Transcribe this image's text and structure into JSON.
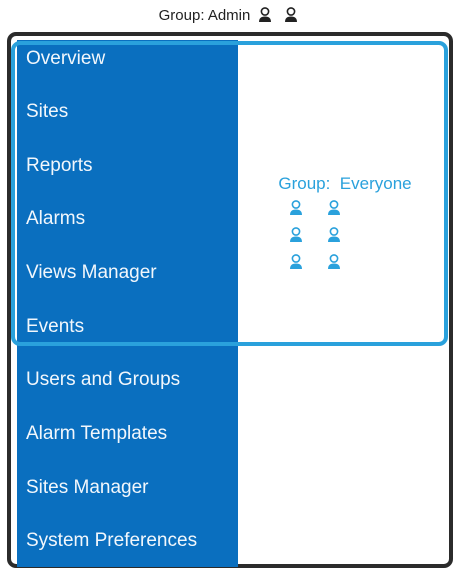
{
  "admin_group": {
    "title": "Group: Admin",
    "icons": [
      "person-icon",
      "person-icon"
    ]
  },
  "menu": {
    "items": [
      {
        "label": "Overview"
      },
      {
        "label": "Sites"
      },
      {
        "label": "Reports"
      },
      {
        "label": "Alarms"
      },
      {
        "label": "Views Manager"
      },
      {
        "label": "Events"
      },
      {
        "label": "Users and Groups"
      },
      {
        "label": "Alarm Templates"
      },
      {
        "label": "Sites Manager"
      },
      {
        "label": "System Preferences"
      }
    ]
  },
  "everyone_group": {
    "title": "Group:  Everyone",
    "icons": [
      "person-icon",
      "person-icon",
      "person-icon",
      "person-icon",
      "person-icon",
      "person-icon"
    ]
  },
  "colors": {
    "menu_background": "#0a6fbf",
    "menu_text": "#f2f7fc",
    "everyone_accent": "#2aa1dc",
    "admin_frame": "#2b2b2b"
  }
}
